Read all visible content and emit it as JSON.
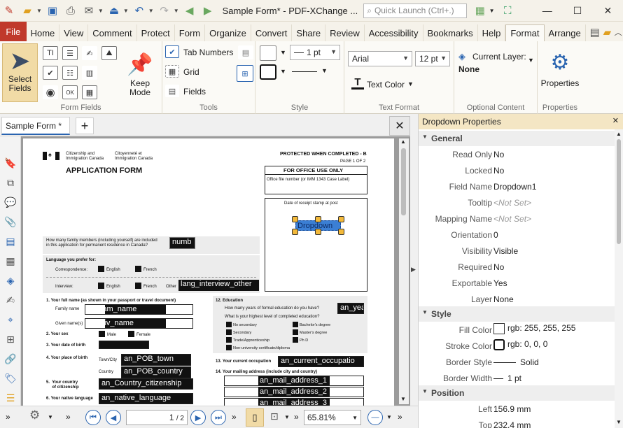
{
  "window": {
    "title": "Sample Form* - PDF-XChange ...",
    "search_placeholder": "Quick Launch (Ctrl+.)"
  },
  "ribbon_tabs": [
    "File",
    "Home",
    "View",
    "Comment",
    "Protect",
    "Form",
    "Organize",
    "Convert",
    "Share",
    "Review",
    "Accessibility",
    "Bookmarks",
    "Help",
    "Format",
    "Arrange"
  ],
  "active_tab": "Format",
  "ribbon": {
    "form_fields": {
      "select_label": "Select Fields",
      "keep_mode_label": "Keep Mode",
      "group_label": "Form Fields"
    },
    "tools": {
      "tab_numbers": "Tab Numbers",
      "grid": "Grid",
      "fields": "Fields",
      "group_label": "Tools"
    },
    "style": {
      "line_width": "1 pt",
      "group_label": "Style"
    },
    "text_format": {
      "font": "Arial",
      "size": "12 pt",
      "text_color": "Text Color",
      "group_label": "Text Format"
    },
    "optional_content": {
      "current_layer": "Current Layer:",
      "layer_value": "None",
      "group_label": "Optional Content"
    },
    "properties": {
      "label": "Properties",
      "group_label": "Properties"
    }
  },
  "document": {
    "tab_label": "Sample Form *",
    "page_current": "1",
    "page_total": "/ 2",
    "zoom": "65.81%"
  },
  "pdf_page": {
    "dept1": "Citizenship and\nImmigration Canada",
    "dept2": "Citoyenneté et\nImmigration Canada",
    "protected": "PROTECTED WHEN COMPLETED - B",
    "page_of": "PAGE 1 OF 2",
    "app_title": "APPLICATION FORM",
    "office_use": "FOR OFFICE USE ONLY",
    "office_file": "Office file number (or IMM 1343 Case Label)",
    "date_stamp": "Date of receipt stamp at post",
    "dropdown_field": "Dropdown",
    "family_q": "How many family members (including yourself) are included\nin this application for permanent residence in Canada?",
    "numb": "numb",
    "lang_pref": "Language you prefer for:",
    "correspondence": "Correspondence:",
    "interview": "Interview:",
    "english": "English",
    "french": "French",
    "other": "Other",
    "lang_other": "lang_interview_other",
    "s1": "1.  Your full name (as shown in your passport or travel document)",
    "family_name": "Family name",
    "given_names": "Given name(s)",
    "fam_field": "an_fam_name",
    "giv_field": "an_giv_name",
    "s2": "2.  Your sex",
    "male": "Male",
    "female": "Female",
    "s3": "3.  Your date of birth",
    "s4": "4.  Your place of birth",
    "town_city": "Town/City",
    "country": "Country",
    "pob_town": "an_POB_town",
    "pob_country": "an_POB_country",
    "s5": "5.  Your country\n     of citizenship",
    "country_cit": "an_Country_citizenship",
    "s6": "6.  Your native language",
    "native_lang": "an_native_language",
    "s12": "12.  Education",
    "edu_q1": "How many years of formal education do you have?",
    "edu_q2": "What is your highest level of completed education?",
    "an_yea": "an_yea",
    "no_secondary": "No secondary",
    "secondary": "Secondary",
    "trade": "Trade/Apprenticeship",
    "non_uni": "Non-university certificate/diploma",
    "bachelors": "Bachelor's degree",
    "masters": "Master's degree",
    "phd": "Ph D",
    "s13": "13.  Your current occupation",
    "occupation": "an_current_occupatio",
    "s14": "14.  Your mailing address (include city and country)",
    "mail1": "an_mail_address_1",
    "mail2": "an_mail_address_2",
    "mail3": "an_mail_address_3"
  },
  "properties_panel": {
    "title": "Dropdown Properties",
    "sections": {
      "general": "General",
      "style": "Style",
      "position": "Position"
    },
    "general": [
      {
        "k": "Read Only",
        "v": "No"
      },
      {
        "k": "Locked",
        "v": "No"
      },
      {
        "k": "Field Name",
        "v": "Dropdown1"
      },
      {
        "k": "Tooltip",
        "v": "<Not Set>"
      },
      {
        "k": "Mapping Name",
        "v": "<Not Set>"
      },
      {
        "k": "Orientation",
        "v": "0"
      },
      {
        "k": "Visibility",
        "v": "Visible"
      },
      {
        "k": "Required",
        "v": "No"
      },
      {
        "k": "Exportable",
        "v": "Yes"
      },
      {
        "k": "Layer",
        "v": "None"
      }
    ],
    "style": [
      {
        "k": "Fill Color",
        "v": "rgb: 255, 255, 255"
      },
      {
        "k": "Stroke Color",
        "v": "rgb: 0, 0, 0"
      },
      {
        "k": "Border Style",
        "v": "Solid"
      },
      {
        "k": "Border Width",
        "v": "1 pt"
      }
    ],
    "position": [
      {
        "k": "Left",
        "v": "156.9 mm"
      },
      {
        "k": "Top",
        "v": "232.4 mm"
      }
    ]
  },
  "colors": {
    "accent": "#2a64b0",
    "file_tab": "#c0392b",
    "panel_header": "#f4e6c4",
    "selected_button": "#f1dba6"
  }
}
